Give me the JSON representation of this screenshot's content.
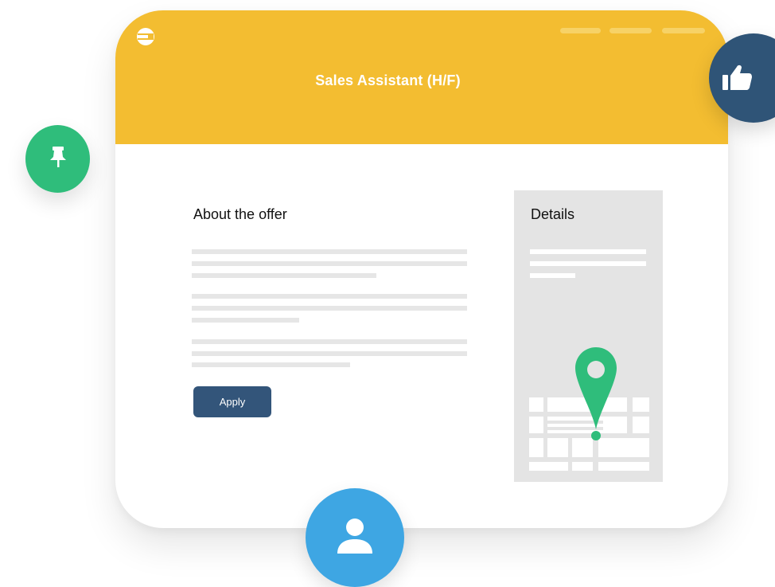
{
  "header": {
    "title": "Sales Assistant (H/F)",
    "logo_icon": "menu-logo-icon",
    "nav_items": [
      "nav-placeholder-1",
      "nav-placeholder-2",
      "nav-placeholder-3"
    ]
  },
  "offer": {
    "heading": "About the offer",
    "apply_label": "Apply"
  },
  "details": {
    "heading": "Details",
    "map_icon": "location-pin-icon"
  },
  "floating_icons": [
    "thumbs-up-icon",
    "pushpin-icon",
    "user-icon"
  ],
  "colors": {
    "header": "#f3bd31",
    "primary": "#33557a",
    "green": "#2fbd7b",
    "blue": "#3ea6e3",
    "panel": "#e4e4e4",
    "placeholder": "#e6e6e6"
  }
}
